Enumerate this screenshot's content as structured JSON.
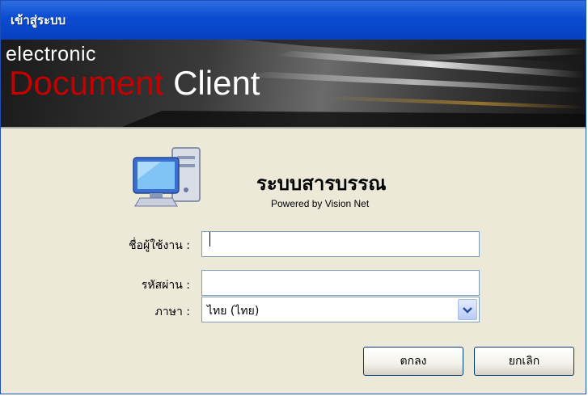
{
  "window": {
    "title": "เข้าสู่ระบบ",
    "accent": "#0a4bd0"
  },
  "banner": {
    "line1": "electronic",
    "line2_red": "Document",
    "line2_white": " Client"
  },
  "app": {
    "icon": "computer-icon",
    "title": "ระบบสารบรรณ",
    "powered_by": "Powered by Vision Net"
  },
  "form": {
    "username_label": "ชื่อผู้ใช้งาน :",
    "username_value": "",
    "password_label": "รหัสผ่าน :",
    "password_value": "",
    "language_label": "ภาษา :",
    "language_value": "ไทย (ไทย)"
  },
  "buttons": {
    "ok": "ตกลง",
    "cancel": "ยกเลิก"
  }
}
